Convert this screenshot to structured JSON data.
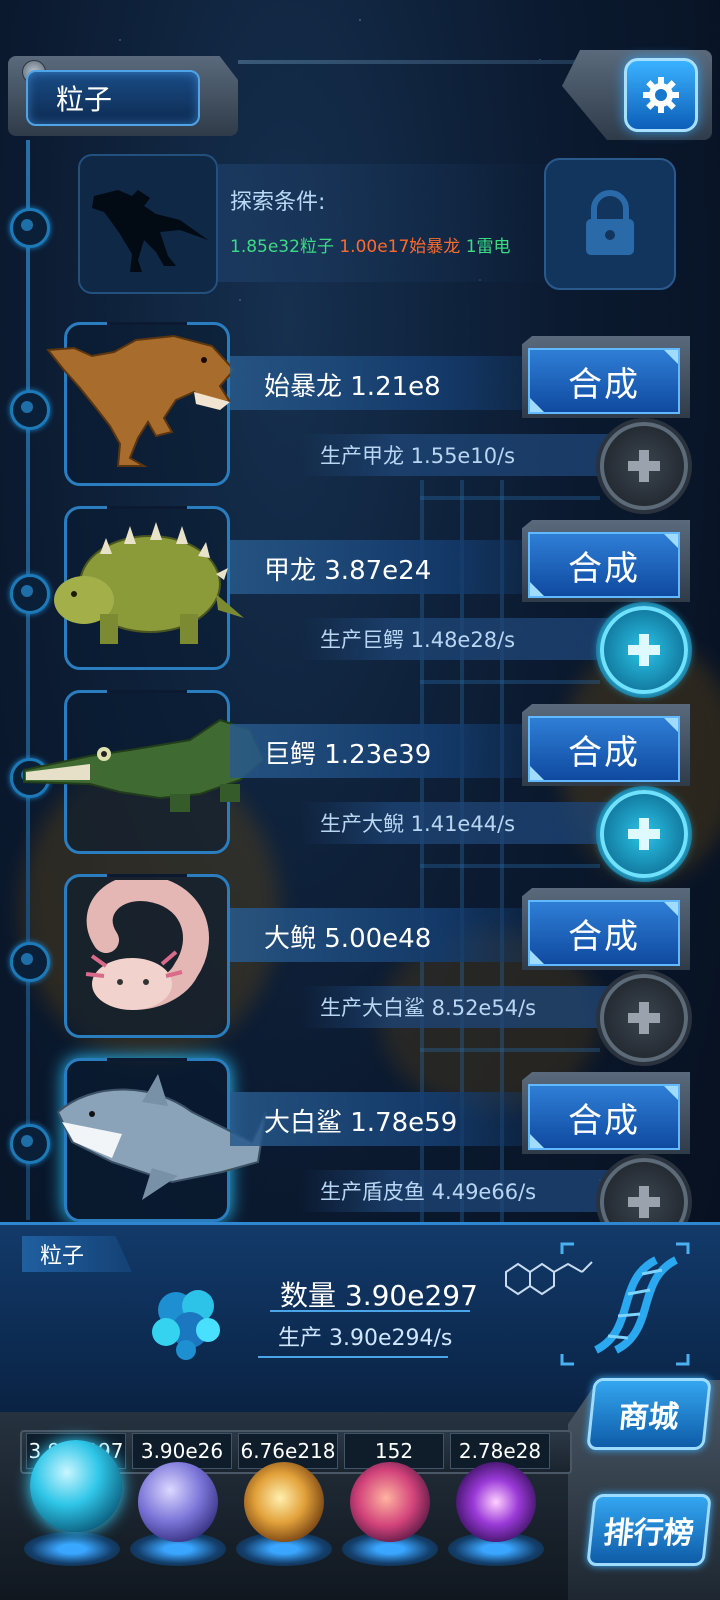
{
  "header": {
    "title": "粒子"
  },
  "locked_item": {
    "condition_label": "探索条件:",
    "requirements": [
      {
        "text": "1.85e32粒子",
        "color": "#3ddc84"
      },
      {
        "text": "1.00e17始暴龙",
        "color": "#ff6a2a"
      },
      {
        "text": "1雷电",
        "color": "#3ddc84"
      }
    ]
  },
  "creatures": [
    {
      "name_line": "始暴龙 1.21e8",
      "produce_line": "生产甲龙 1.55e10/s",
      "combine_label": "合成",
      "plus_active": false
    },
    {
      "name_line": "甲龙 3.87e24",
      "produce_line": "生产巨鳄 1.48e28/s",
      "combine_label": "合成",
      "plus_active": true
    },
    {
      "name_line": "巨鳄 1.23e39",
      "produce_line": "生产大鲵 1.41e44/s",
      "combine_label": "合成",
      "plus_active": true
    },
    {
      "name_line": "大鲵 5.00e48",
      "produce_line": "生产大白鲨 8.52e54/s",
      "combine_label": "合成",
      "plus_active": false
    },
    {
      "name_line": "大白鲨 1.78e59",
      "produce_line": "生产盾皮鱼 4.49e66/s",
      "combine_label": "合成",
      "plus_active": false
    }
  ],
  "particle_panel": {
    "tag": "粒子",
    "quantity": "数量 3.90e297",
    "production": "生产 3.90e294/s"
  },
  "resources": [
    {
      "value": "3.90e297",
      "icon": "particle-orb",
      "color": "#2fc6e8"
    },
    {
      "value": "3.90e26",
      "icon": "lightning-orb",
      "color": "#7a74d8"
    },
    {
      "value": "6.76e218",
      "icon": "fire-orb",
      "color": "#e2a13a"
    },
    {
      "value": "152",
      "icon": "brain-orb",
      "color": "#d2437a"
    },
    {
      "value": "2.78e28",
      "icon": "vortex-orb",
      "color": "#9a3ad8"
    }
  ],
  "side_buttons": {
    "shop": "商城",
    "ranking": "排行榜"
  }
}
